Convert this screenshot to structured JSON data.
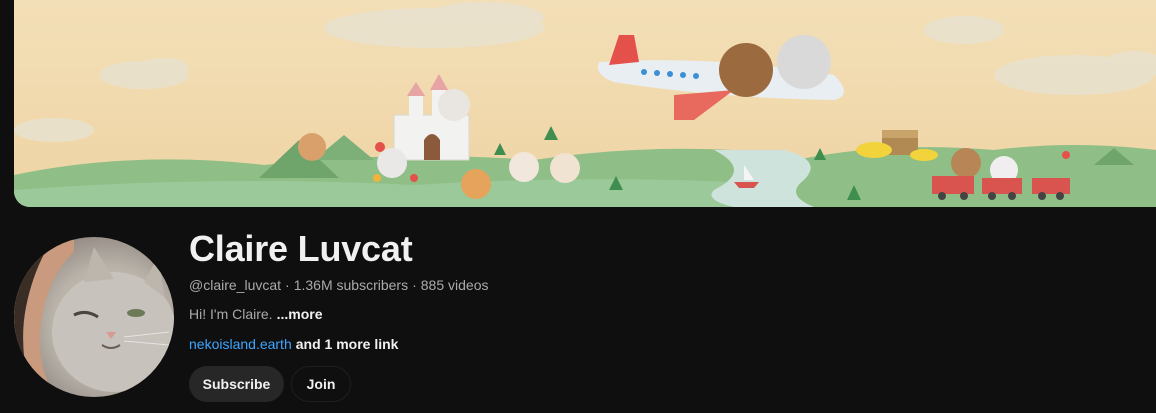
{
  "channel": {
    "name": "Claire Luvcat",
    "handle": "@claire_luvcat",
    "subscribers": "1.36M subscribers",
    "videos": "885 videos",
    "separator": "·",
    "description": "Hi! I'm Claire.",
    "more_label": "...more",
    "link": "nekoisland.earth",
    "more_links": "and 1 more link"
  },
  "actions": {
    "subscribe_label": "Subscribe",
    "join_label": "Join"
  },
  "colors": {
    "background": "#0f0f0f",
    "button_bg": "#272727",
    "link": "#3ea6ff",
    "meta_text": "#aaaaaa"
  },
  "banner": {
    "description_icons": [
      "airplane-icon",
      "castle-icon",
      "train-icon",
      "treasure-chest-icon",
      "boat-icon"
    ]
  }
}
